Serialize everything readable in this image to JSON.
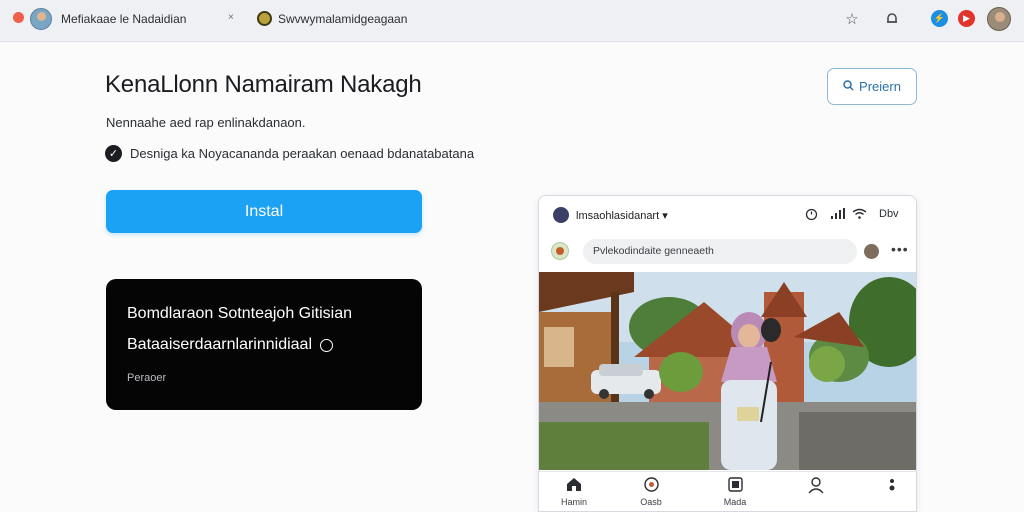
{
  "browser": {
    "tab_title": "Mefiakaae le Nadaidian",
    "tab_close": "×",
    "url": "Swvwymalamidgeagaan",
    "accent": "#1ba2f5"
  },
  "main": {
    "heading": "KenaLlonn Namairam Nakagh",
    "subtext": "Nennaahe aed rap enlinakdanaon.",
    "checklist_text": "Desniga ka Noyacananda peraakan oenaad bdanatabatana",
    "install_label": "Instal",
    "preview_label": "Preiern"
  },
  "promo": {
    "line1": "Bomdlaraon Sotnteajoh Gitisian",
    "line2": "Bataaiserdaarnlarinnidiaal",
    "small": "Peraoer"
  },
  "app": {
    "title": "lmsaohlasidanart",
    "status_time": "Dbv",
    "search_text": "Pvlekodindaite genneaeth",
    "more": "•••",
    "tabs": [
      {
        "label": "Hamin",
        "icon": "home-icon"
      },
      {
        "label": "Oasb",
        "icon": "compass-icon"
      },
      {
        "label": "Mada",
        "icon": "media-icon"
      },
      {
        "label": "",
        "icon": "profile-icon"
      },
      {
        "label": "",
        "icon": "more-icon"
      }
    ]
  }
}
